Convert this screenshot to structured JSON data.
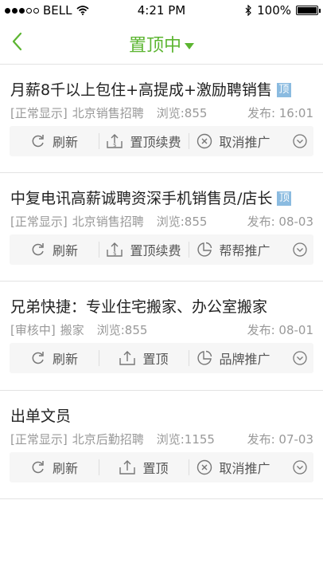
{
  "status_bar": {
    "carrier": "BELL",
    "time": "4:21 PM",
    "battery": "100%",
    "battery_level": 1.0
  },
  "nav": {
    "title": "置顶中"
  },
  "colors": {
    "accent": "#5cb531",
    "badge": "#8bbbe0",
    "meta": "#999999"
  },
  "listings": [
    {
      "title": "月薪8千以上包住+高提成+激励聘销售",
      "badge": "顶",
      "status": "[正常显示]",
      "category": "北京销售招聘",
      "views": "浏览:855",
      "date": "发布:  16:01",
      "actions": [
        {
          "icon": "refresh-icon",
          "label": "刷新"
        },
        {
          "icon": "pin-top-fee-icon",
          "label": "置顶续费"
        },
        {
          "icon": "cancel-circle-icon",
          "label": "取消推广"
        }
      ]
    },
    {
      "title": "中复电讯高薪诚聘资深手机销售员/店长",
      "badge": "顶",
      "status": "[正常显示]",
      "category": "北京销售招聘",
      "views": "浏览:855",
      "date": "发布: 08-03",
      "actions": [
        {
          "icon": "refresh-icon",
          "label": "刷新"
        },
        {
          "icon": "pin-top-fee-icon",
          "label": "置顶续费"
        },
        {
          "icon": "promote-icon",
          "label": "帮帮推广"
        }
      ]
    },
    {
      "title": "兄弟快捷：专业住宅搬家、办公室搬家",
      "badge": "",
      "status": "[审核中]",
      "category": "搬家",
      "views": "浏览:855",
      "date": "发布: 08-01",
      "actions": [
        {
          "icon": "refresh-icon",
          "label": "刷新"
        },
        {
          "icon": "pin-top-icon",
          "label": "置顶"
        },
        {
          "icon": "promote-icon",
          "label": "品牌推广"
        }
      ]
    },
    {
      "title": "出单文员",
      "badge": "",
      "status": "[正常显示]",
      "category": "北京后勤招聘",
      "views": "浏览:1155",
      "date": "发布: 07-03",
      "actions": [
        {
          "icon": "refresh-icon",
          "label": "刷新"
        },
        {
          "icon": "pin-top-icon",
          "label": "置顶"
        },
        {
          "icon": "cancel-circle-icon",
          "label": "取消推广"
        }
      ]
    }
  ]
}
